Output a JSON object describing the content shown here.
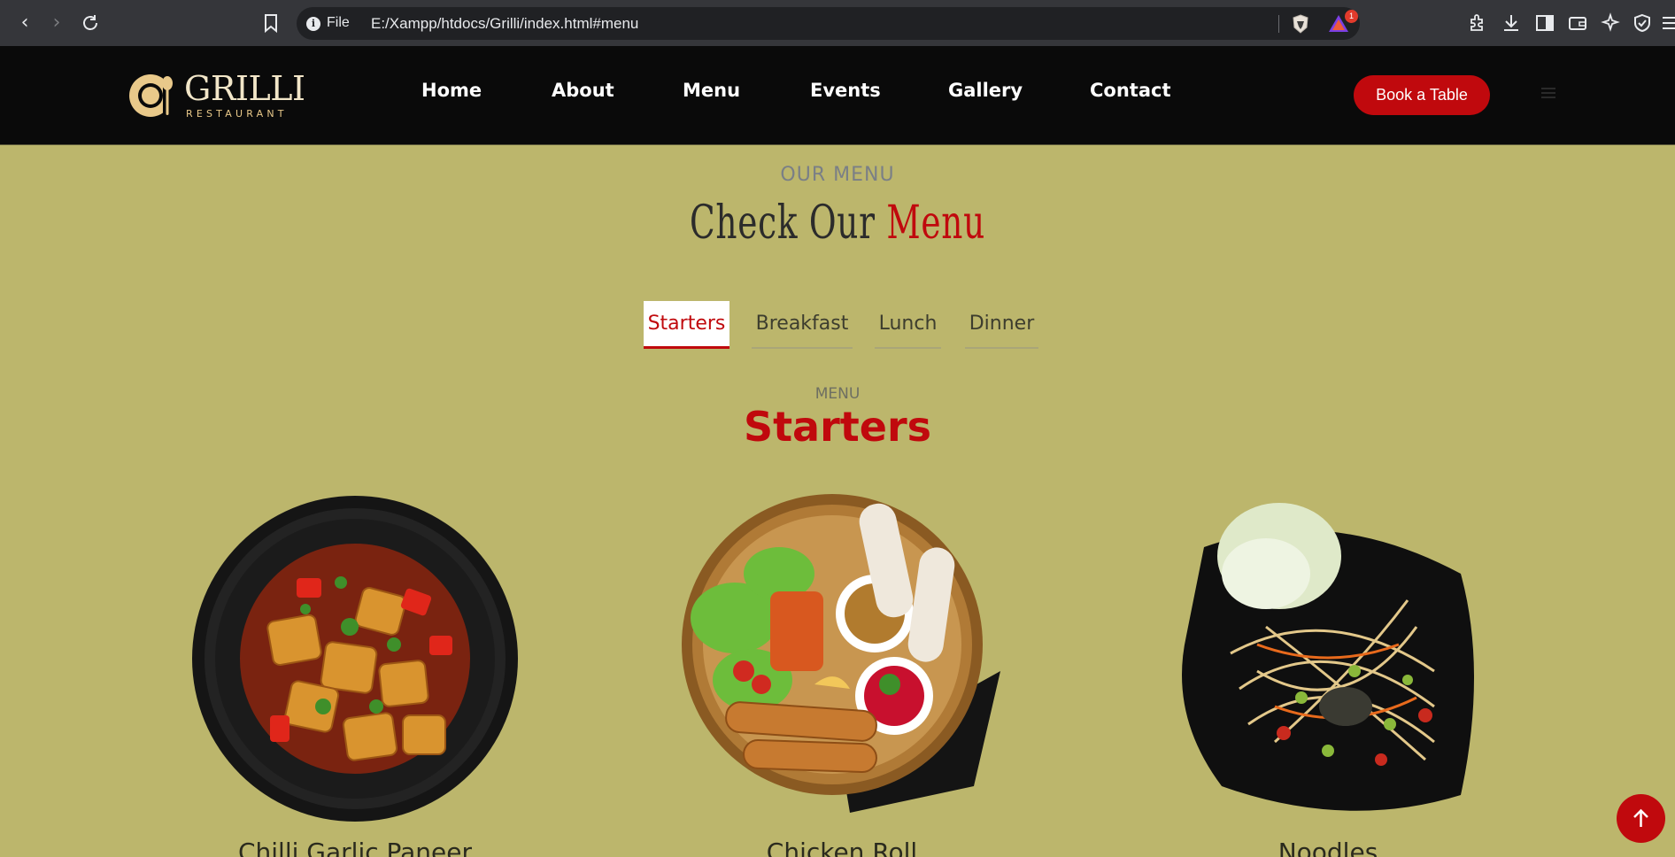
{
  "browser": {
    "address_label": "File",
    "url": "E:/Xampp/htdocs/Grilli/index.html#menu",
    "rewards_badge": "1"
  },
  "header": {
    "logo_name": "GRILLI",
    "logo_sub": "RESTAURANT",
    "nav": [
      {
        "label": "Home"
      },
      {
        "label": "About"
      },
      {
        "label": "Menu"
      },
      {
        "label": "Events"
      },
      {
        "label": "Gallery"
      },
      {
        "label": "Contact"
      }
    ],
    "cta": "Book a Table"
  },
  "section": {
    "eyebrow": "OUR MENU",
    "title_part1": "Check Our",
    "title_part2": "Menu"
  },
  "tabs": [
    {
      "label": "Starters",
      "active": true
    },
    {
      "label": "Breakfast",
      "active": false
    },
    {
      "label": "Lunch",
      "active": false
    },
    {
      "label": "Dinner",
      "active": false
    }
  ],
  "menu": {
    "eyebrow": "MENU",
    "heading": "Starters",
    "items": [
      {
        "name": "Chilli Garlic Paneer"
      },
      {
        "name": "Chicken Roll"
      },
      {
        "name": "Noodles"
      }
    ]
  },
  "colors": {
    "background": "#bcb66c",
    "accent": "#c0090d",
    "header": "#0a0a0a"
  }
}
